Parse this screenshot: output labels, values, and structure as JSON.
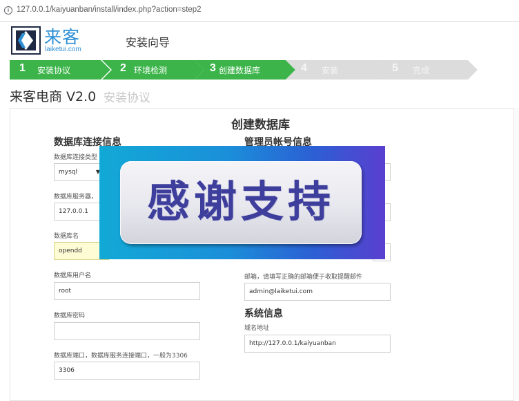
{
  "browser": {
    "url": "127.0.0.1/kaiyuanban/install/index.php?action=step2",
    "info_icon": "info-icon"
  },
  "header": {
    "logo_icon": "laike-logo",
    "logo_text": "来客",
    "logo_sub": "laiketui.com",
    "wizard_title": "安装向导"
  },
  "steps": [
    {
      "num": "1",
      "label": "安装协议",
      "state": "done"
    },
    {
      "num": "2",
      "label": "环境检测",
      "state": "done"
    },
    {
      "num": "3",
      "label": "创建数据库",
      "state": "current"
    },
    {
      "num": "4",
      "label": "安装",
      "state": "pending"
    },
    {
      "num": "5",
      "label": "完成",
      "state": "pending"
    }
  ],
  "colors": {
    "step_active": "#3cb44a",
    "step_inactive": "#dcdcdc",
    "logo_blue": "#2d8fd5",
    "input_focus_bg": "#fefcd4"
  },
  "page": {
    "product": "来客电商 V2.0",
    "subhead": "安装协议",
    "panel_title": "创建数据库"
  },
  "db": {
    "heading": "数据库连接信息",
    "type_label": "数据库连接类型",
    "type_value": "mysql",
    "server_label": "数据库服务器，",
    "server_value": "127.0.0.1",
    "name_label": "数据库名",
    "name_value": "opendd",
    "user_label": "数据库用户名",
    "user_value": "root",
    "pass_label": "数据库密码",
    "pass_value": "",
    "port_label": "数据库端口，数据库服务连接端口，一般为3306",
    "port_value": "3306"
  },
  "admin": {
    "heading": "管理员帐号信息",
    "email_label": "邮箱，请填写正确的邮箱便于收取提醒邮件",
    "email_value": "admin@laiketui.com"
  },
  "system": {
    "heading": "系统信息",
    "domain_label": "域名地址",
    "domain_value": "http://127.0.0.1/kaiyuanban"
  },
  "overlay": {
    "text": "感谢支持"
  }
}
